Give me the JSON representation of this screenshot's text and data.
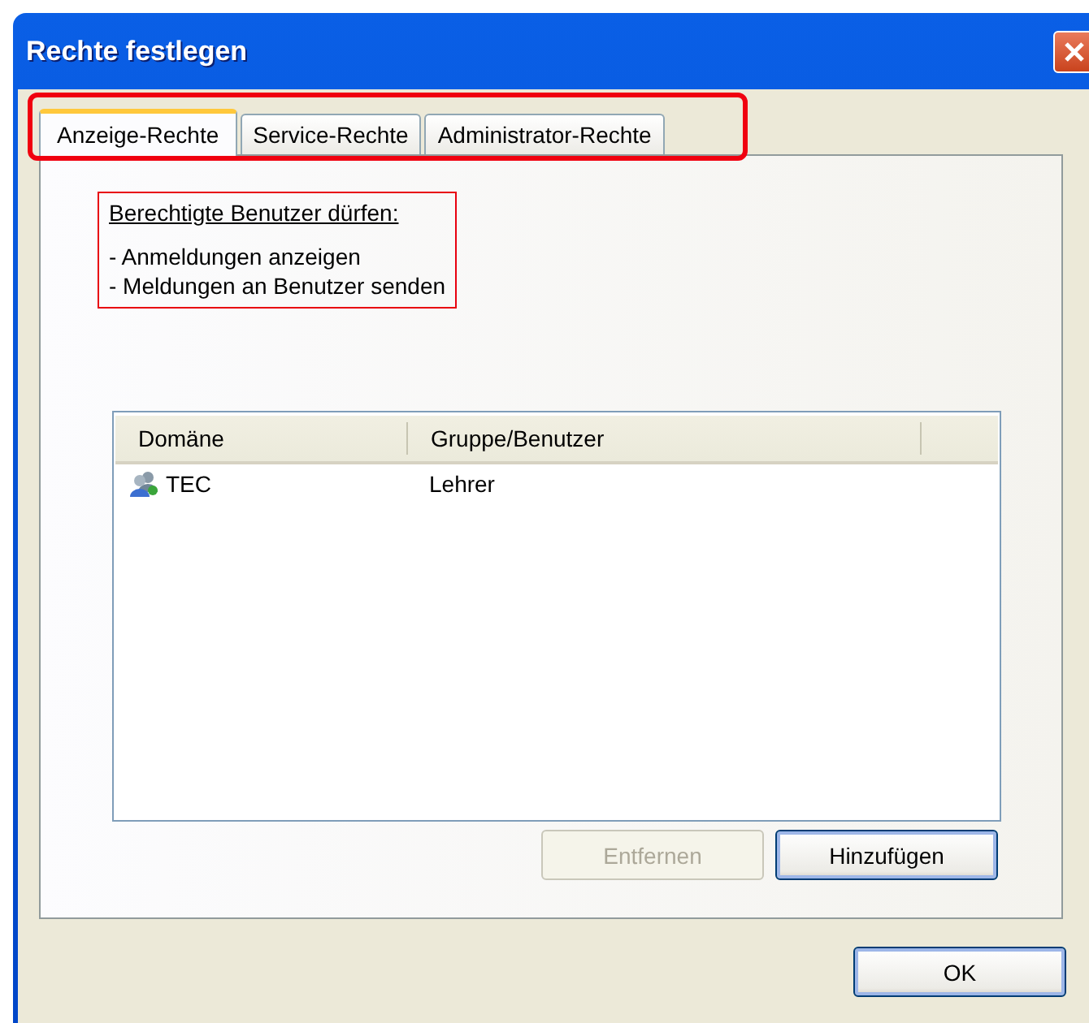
{
  "window": {
    "title": "Rechte festlegen"
  },
  "tabs": [
    {
      "label": "Anzeige-Rechte",
      "selected": true
    },
    {
      "label": "Service-Rechte",
      "selected": false
    },
    {
      "label": "Administrator-Rechte",
      "selected": false
    }
  ],
  "info": {
    "heading": "Berechtigte Benutzer dürfen:",
    "lines": [
      "- Anmeldungen anzeigen",
      "- Meldungen an Benutzer senden"
    ]
  },
  "table": {
    "columns": [
      "Domäne",
      "Gruppe/Benutzer"
    ],
    "rows": [
      {
        "cells": [
          "TEC",
          "Lehrer"
        ],
        "kind": "group"
      }
    ]
  },
  "buttons": [
    {
      "label": "Entfernen",
      "disabled": true
    },
    {
      "label": "Hinzufügen",
      "disabled": false
    }
  ],
  "footer_buttons": [
    {
      "label": "OK",
      "disabled": false
    }
  ]
}
